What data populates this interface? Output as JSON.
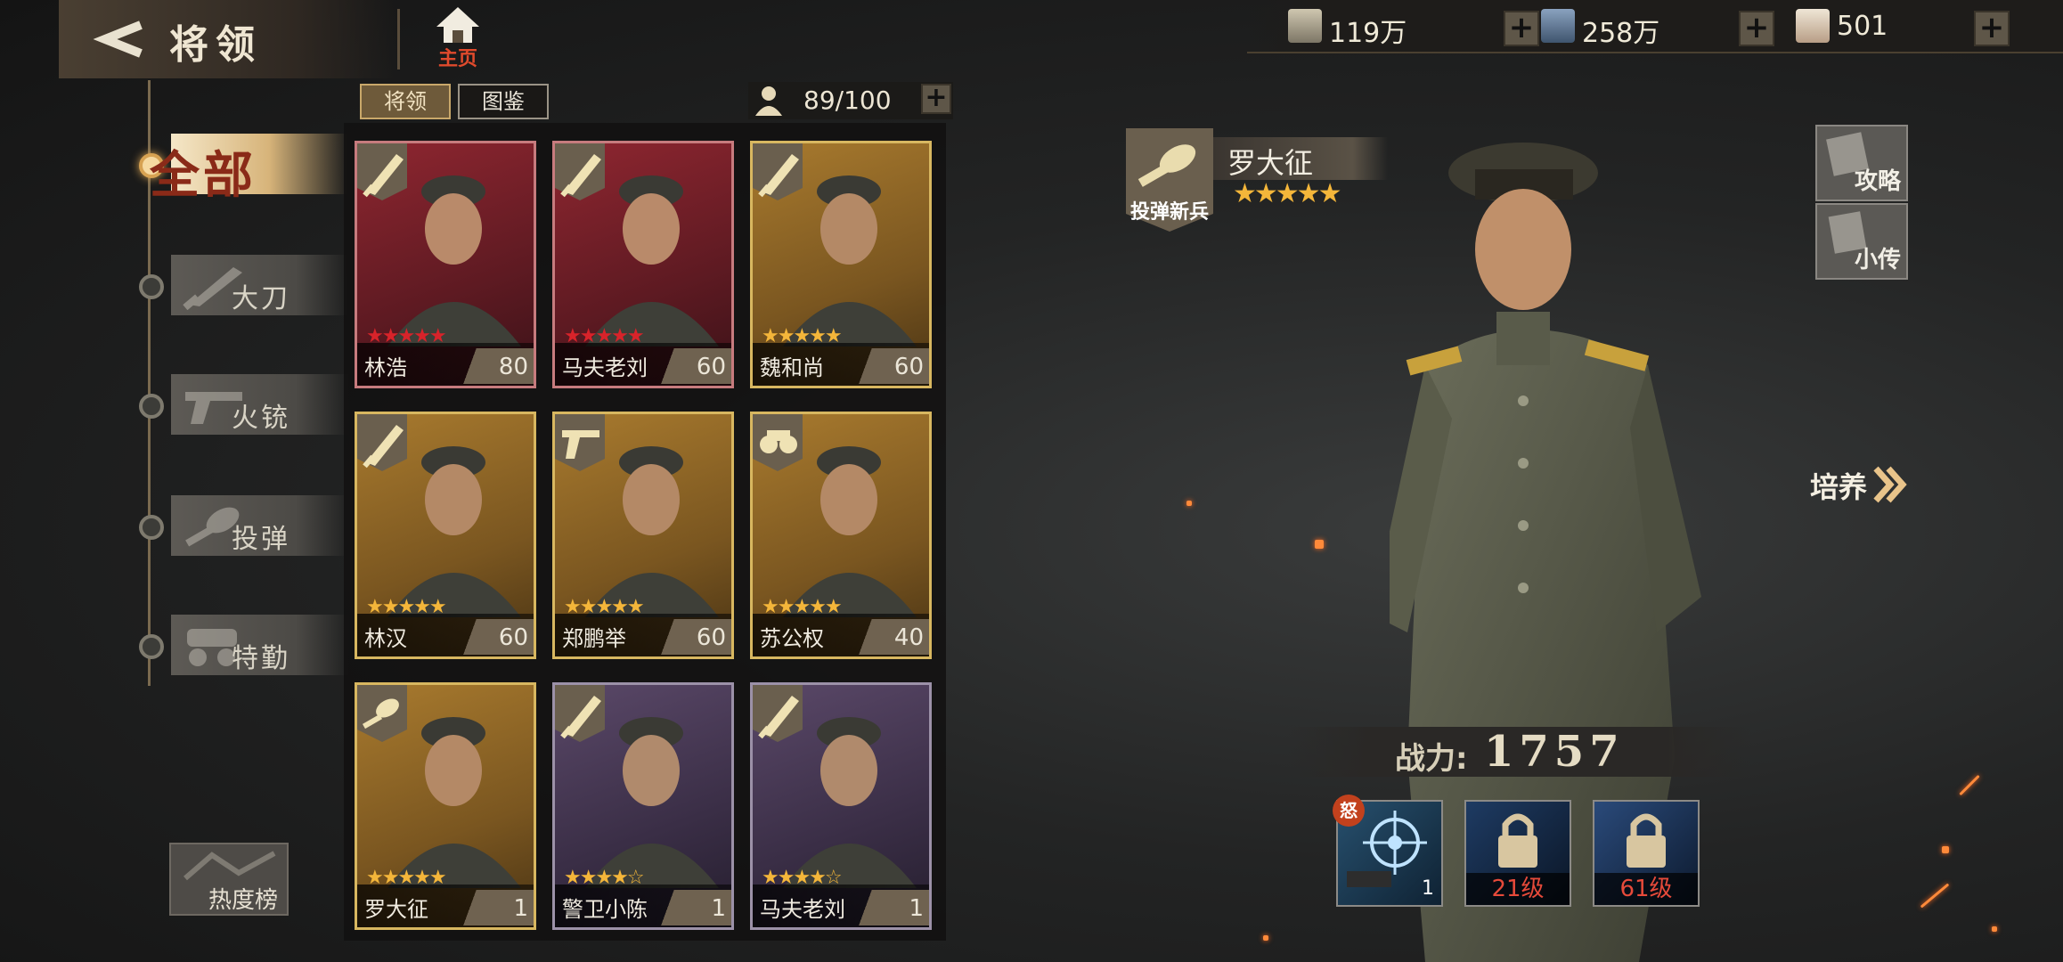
{
  "header": {
    "title": "将领",
    "home_label": "主页"
  },
  "resources": [
    {
      "icon": "silver-coins-icon",
      "value": "119万"
    },
    {
      "icon": "book-icon",
      "value": "258万"
    },
    {
      "icon": "ticket-icon",
      "value": "501"
    }
  ],
  "filters": [
    {
      "label": "全部",
      "icon": "all-icon",
      "active": true
    },
    {
      "label": "大刀",
      "icon": "broadsword-icon",
      "active": false
    },
    {
      "label": "火铳",
      "icon": "pistol-icon",
      "active": false
    },
    {
      "label": "投弹",
      "icon": "grenade-icon",
      "active": false
    },
    {
      "label": "特勤",
      "icon": "special-ops-icon",
      "active": false
    }
  ],
  "heat_ranking_label": "热度榜",
  "tabs": {
    "generals": "将领",
    "codex": "图鉴"
  },
  "capacity": "89/100",
  "generals": [
    {
      "name": "林浩",
      "level": "80",
      "stars": "★★★★★",
      "rarity": "red",
      "weapon": "broadsword-icon"
    },
    {
      "name": "马夫老刘",
      "level": "60",
      "stars": "★★★★★",
      "rarity": "red",
      "weapon": "broadsword-icon"
    },
    {
      "name": "魏和尚",
      "level": "60",
      "stars": "★★★★★",
      "rarity": "gold",
      "weapon": "broadsword-icon"
    },
    {
      "name": "林汉",
      "level": "60",
      "stars": "★★★★★",
      "rarity": "gold",
      "weapon": "broadsword-icon"
    },
    {
      "name": "郑鹏举",
      "level": "60",
      "stars": "★★★★★",
      "rarity": "gold",
      "weapon": "pistol-icon"
    },
    {
      "name": "苏公权",
      "level": "40",
      "stars": "★★★★★",
      "rarity": "gold",
      "weapon": "binoculars-icon"
    },
    {
      "name": "罗大征",
      "level": "1",
      "stars": "★★★★★",
      "rarity": "gold",
      "weapon": "grenade-icon"
    },
    {
      "name": "警卫小陈",
      "level": "1",
      "stars": "★★★★☆",
      "rarity": "purple",
      "weapon": "broadsword-icon"
    },
    {
      "name": "马夫老刘",
      "level": "1",
      "stars": "★★★★☆",
      "rarity": "purple",
      "weapon": "broadsword-icon"
    }
  ],
  "hero": {
    "name": "罗大征",
    "class_label": "投弹新兵",
    "stars": "★★★★★",
    "power_label": "战力:",
    "power_value": "1757",
    "train_label": "培养"
  },
  "side_buttons": {
    "guide": "攻略",
    "biography": "小传"
  },
  "skills": [
    {
      "badge": "怒",
      "caption": "1",
      "locked": false
    },
    {
      "caption": "21级",
      "locked": true
    },
    {
      "caption": "61级",
      "locked": true
    }
  ],
  "colors": {
    "red_frame": "#c77b7e",
    "gold_frame": "#d8b760",
    "purple_frame": "#9c91a8",
    "star_gold": "#f4b63a",
    "star_red": "#d8232a",
    "lock_caption": "#e64a3a"
  }
}
